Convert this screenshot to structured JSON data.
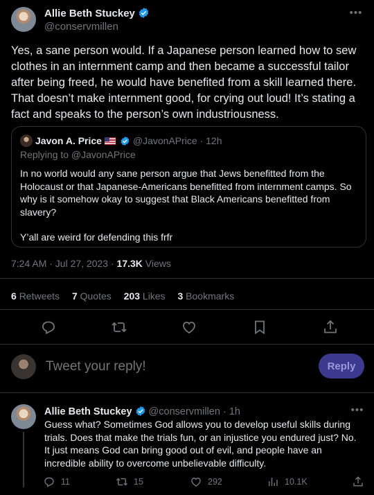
{
  "main_tweet": {
    "author_name": "Allie Beth Stuckey",
    "handle": "@conservmillen",
    "text": "Yes, a sane person would. If a Japanese person learned how to sew clothes in an internment camp and then became a successful tailor after being freed, he would have benefited from a skill learned there. That doesn’t make internment good, for crying out loud! It’s stating a fact and speaks to the person’s own industriousness.",
    "more_icon": "more-horizontal-icon",
    "quote": {
      "author_name": "Javon A. Price",
      "flag": "🇺🇸",
      "handle": "@JavonAPrice",
      "separator": "·",
      "time": "12h",
      "replying_to": "Replying to @JavonAPrice",
      "text": "In no world would any sane person argue that Jews benefitted from the Holocaust or that Japanese-Americans benefitted from internment camps. So why is it somehow okay to suggest that Black Americans benefitted from slavery?",
      "text2": "Y’all are weird for defending this frfr"
    },
    "timestamp": "7:24 AM · Jul 27, 2023 ·",
    "views_count": "17.3K",
    "views_label": "Views",
    "stats": {
      "retweets_count": "6",
      "retweets_label": "Retweets",
      "quotes_count": "7",
      "quotes_label": "Quotes",
      "likes_count": "203",
      "likes_label": "Likes",
      "bookmarks_count": "3",
      "bookmarks_label": "Bookmarks"
    }
  },
  "compose": {
    "placeholder": "Tweet your reply!",
    "button_label": "Reply"
  },
  "reply_tweet": {
    "author_name": "Allie Beth Stuckey",
    "handle": "@conservmillen",
    "separator": "·",
    "time": "1h",
    "text": "Guess what? Sometimes God allows you to develop useful skills during trials. Does that make the trials fun, or an injustice you endured just? No. It just means God can bring good out of evil, and people have an incredible ability to overcome unbelievable difficulty.",
    "replies": "11",
    "retweets": "15",
    "likes": "292",
    "views": "10.1K"
  },
  "colors": {
    "background": "#000000",
    "text": "#e7e9ea",
    "muted": "#71767b",
    "border": "#2f3336",
    "verified": "#1d9bf0",
    "reply_button": "#3c3a8f"
  }
}
